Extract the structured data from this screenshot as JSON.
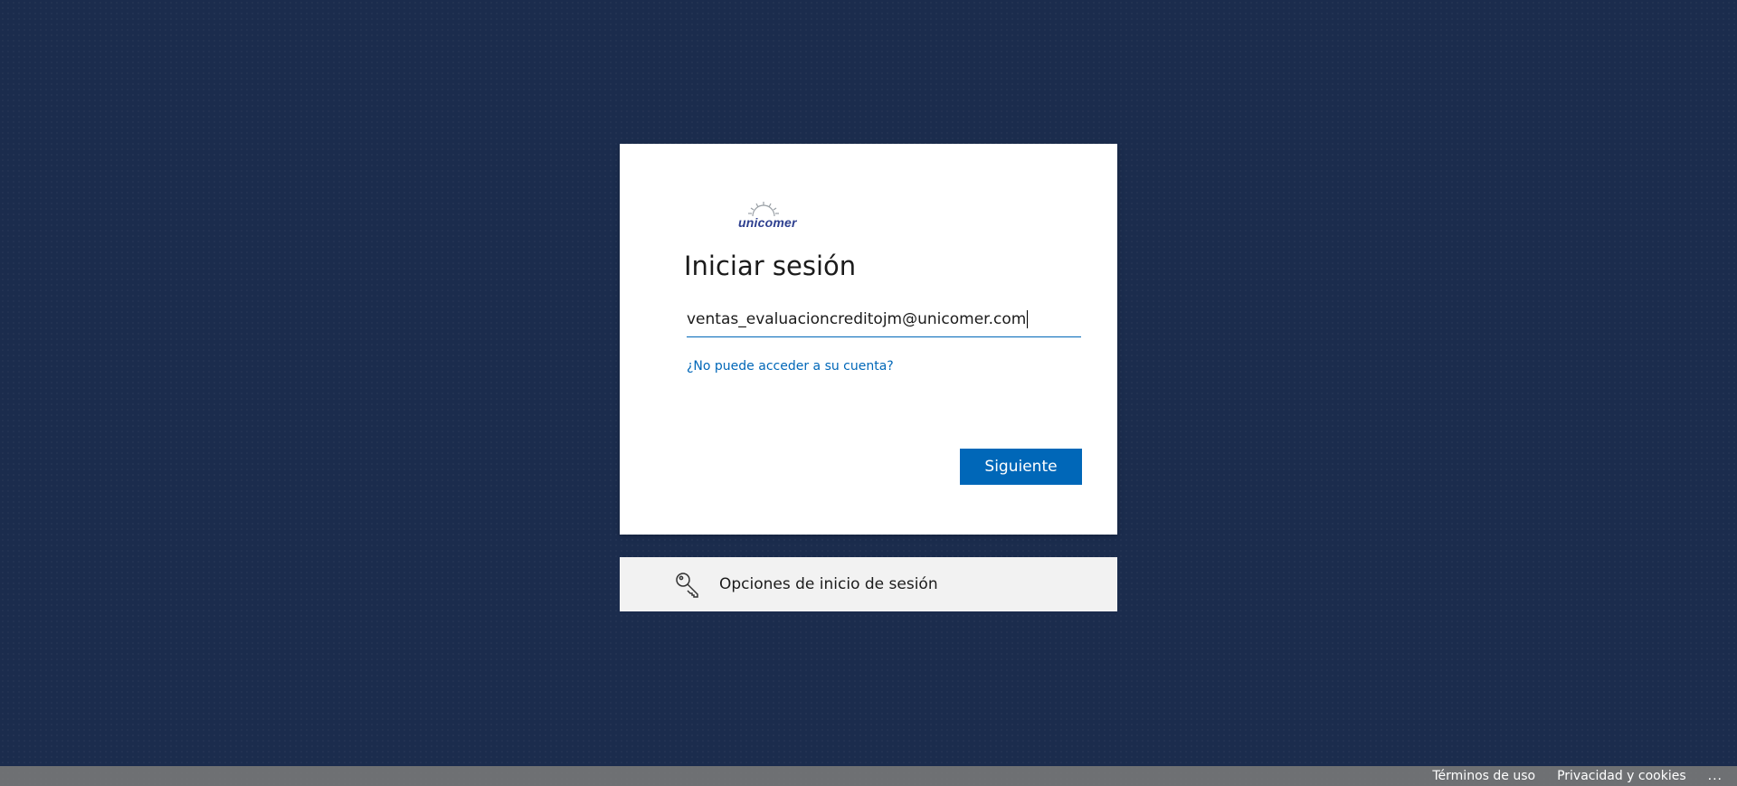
{
  "login": {
    "brand": "unicomer",
    "title": "Iniciar sesión",
    "email_value": "ventas_evaluacioncreditojm@unicomer.com",
    "cant_access_link": "¿No puede acceder a su cuenta?",
    "next_button": "Siguiente"
  },
  "signin_options": {
    "label": "Opciones de inicio de sesión",
    "icon": "key-search-icon"
  },
  "footer": {
    "terms": "Términos de uso",
    "privacy": "Privacidad y cookies",
    "more": "..."
  },
  "colors": {
    "background": "#1b2c4d",
    "accent": "#0067b8",
    "card": "#ffffff",
    "options_bg": "#f2f2f2"
  }
}
